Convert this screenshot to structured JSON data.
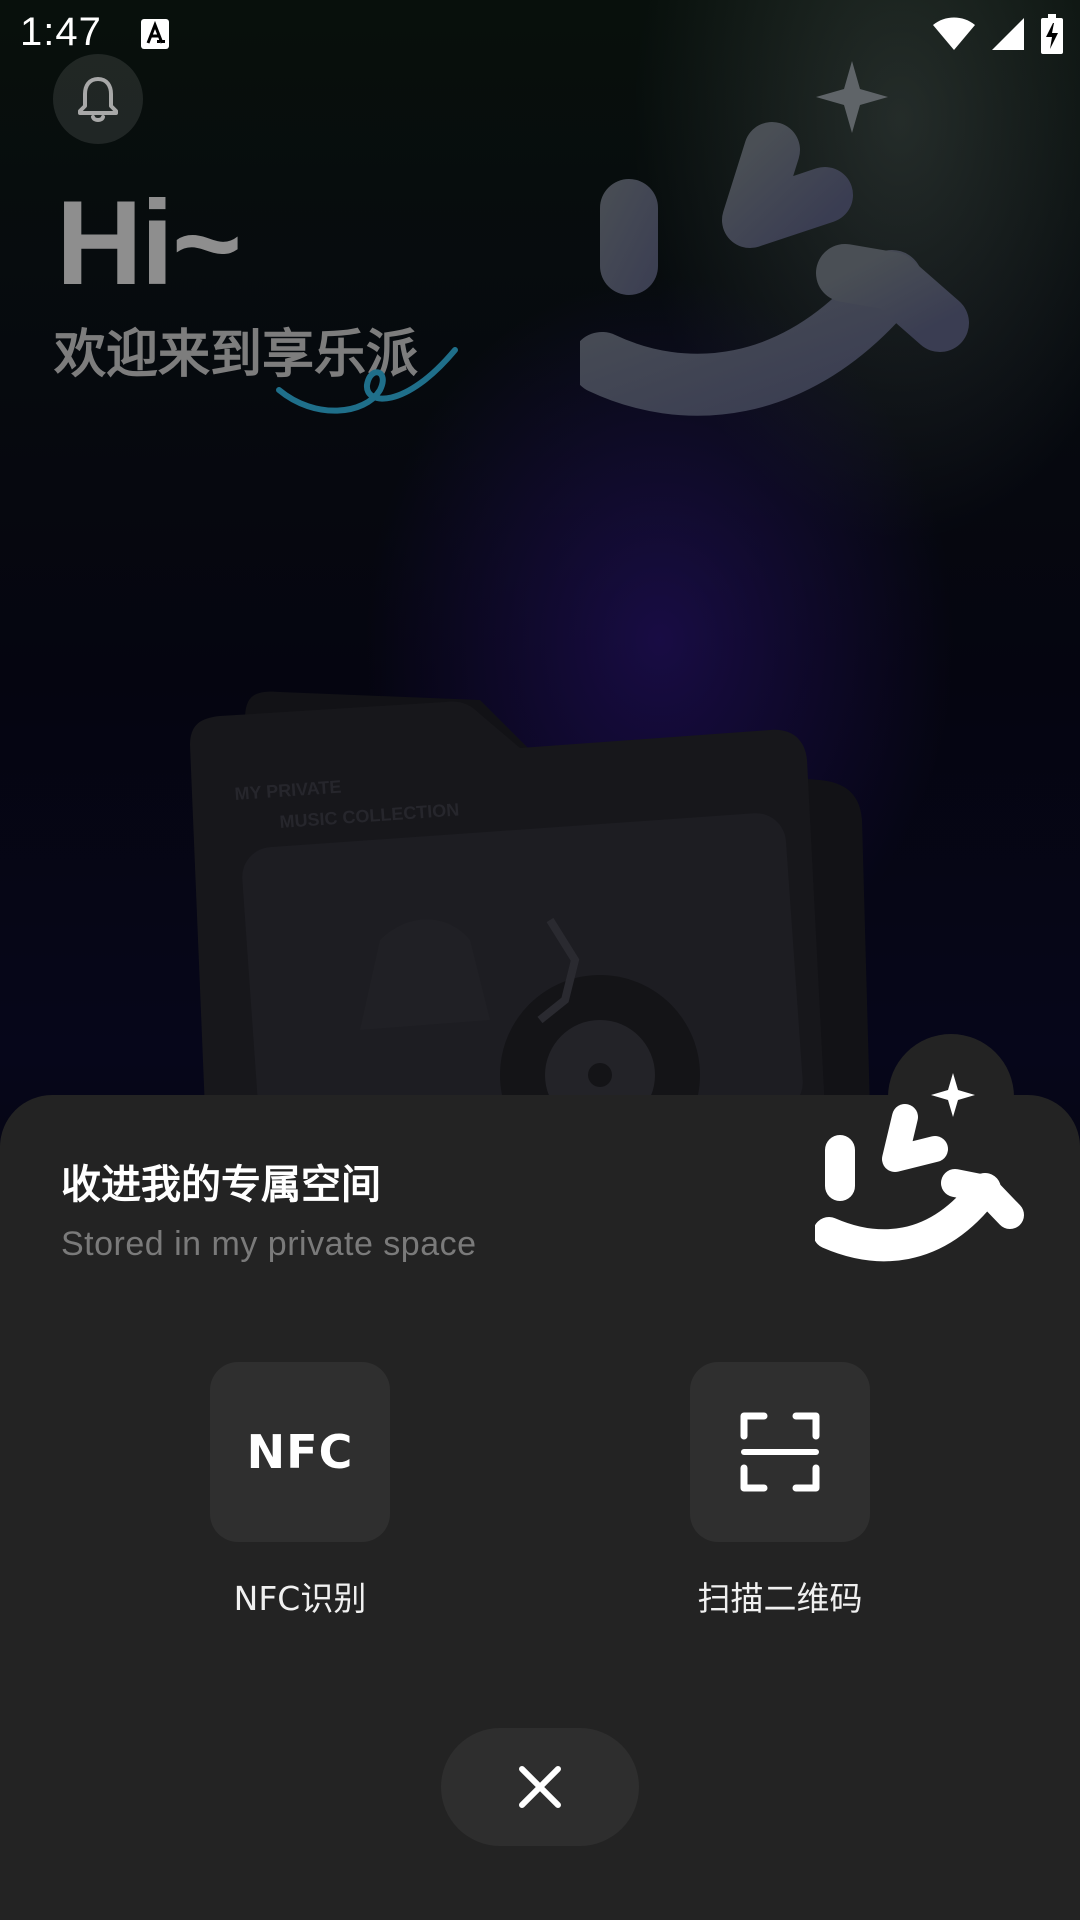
{
  "status_bar": {
    "time": "1:47",
    "notification_icon": "accessibility-font-icon",
    "icons": [
      "wifi-icon",
      "cellular-signal-icon",
      "battery-charging-icon"
    ]
  },
  "header": {
    "bell_icon": "bell-icon",
    "greeting": "Hi~",
    "welcome": "欢迎来到享乐派"
  },
  "sheet": {
    "title": "收进我的专属空间",
    "subtitle": "Stored in my private space",
    "actions": [
      {
        "icon_text": "NFC",
        "label": "NFC识别",
        "icon": "nfc-icon"
      },
      {
        "label": "扫描二维码",
        "icon": "scan-qr-icon"
      }
    ],
    "close_icon": "close-icon"
  },
  "colors": {
    "sheet_bg": "#232323",
    "tile_bg": "#2f2f2f",
    "accent_squiggle": "#1f6f8a"
  }
}
